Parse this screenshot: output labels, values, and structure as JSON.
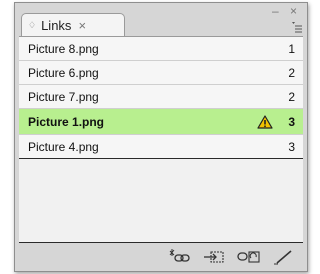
{
  "panel": {
    "tab_label": "Links",
    "tab_arrows": "♢",
    "tab_close": "×",
    "window_controls": "– ×"
  },
  "links": [
    {
      "name": "Picture 8.png",
      "count": "1",
      "warning": false,
      "selected": false
    },
    {
      "name": "Picture 6.png",
      "count": "2",
      "warning": false,
      "selected": false
    },
    {
      "name": "Picture 7.png",
      "count": "2",
      "warning": false,
      "selected": false
    },
    {
      "name": "Picture 1.png",
      "count": "3",
      "warning": true,
      "selected": true
    },
    {
      "name": "Picture 4.png",
      "count": "3",
      "warning": false,
      "selected": false
    }
  ],
  "toolbar": {
    "icons": [
      "relink-icon",
      "go-to-link-icon",
      "update-link-icon",
      "edit-original-icon"
    ]
  },
  "colors": {
    "selected_row": "#b8ef8f",
    "warning": "#f2c200"
  }
}
